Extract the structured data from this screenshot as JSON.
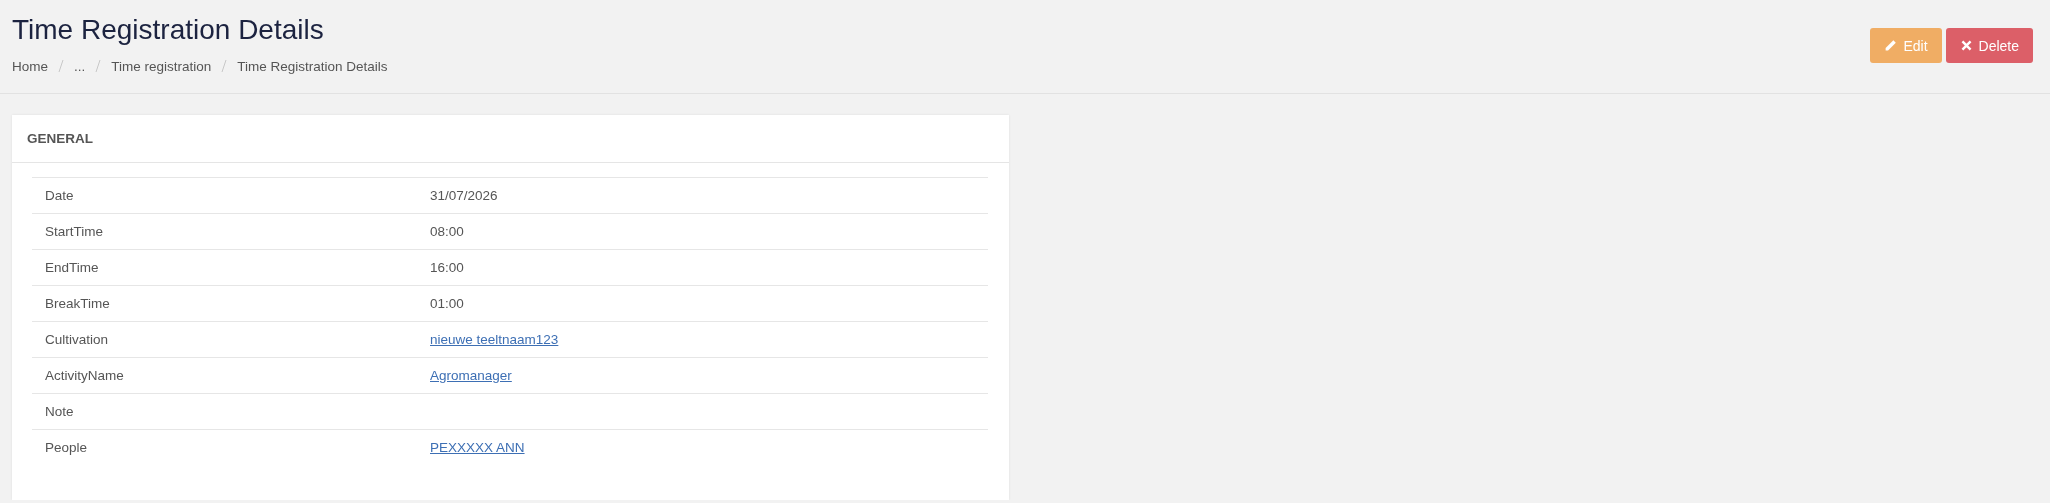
{
  "page_title": "Time Registration Details",
  "breadcrumb": [
    "Home",
    "...",
    "Time registration",
    "Time Registration Details"
  ],
  "actions": [
    {
      "label": "Edit",
      "kind": "edit"
    },
    {
      "label": "Delete",
      "kind": "delete"
    }
  ],
  "card": {
    "title": "GENERAL",
    "rows": [
      {
        "label": "Date",
        "value": "31/07/2026",
        "kind": "text"
      },
      {
        "label": "StartTime",
        "value": "08:00",
        "kind": "text"
      },
      {
        "label": "EndTime",
        "value": "16:00",
        "kind": "text"
      },
      {
        "label": "BreakTime",
        "value": "01:00",
        "kind": "text"
      },
      {
        "label": "Cultivation",
        "value": "nieuwe teeltnaam123",
        "kind": "link"
      },
      {
        "label": "ActivityName",
        "value": "Agromanager",
        "kind": "link"
      },
      {
        "label": "Note"
      },
      {
        "label": "People",
        "value": "PEXXXXX ANN",
        "kind": "link"
      }
    ]
  }
}
